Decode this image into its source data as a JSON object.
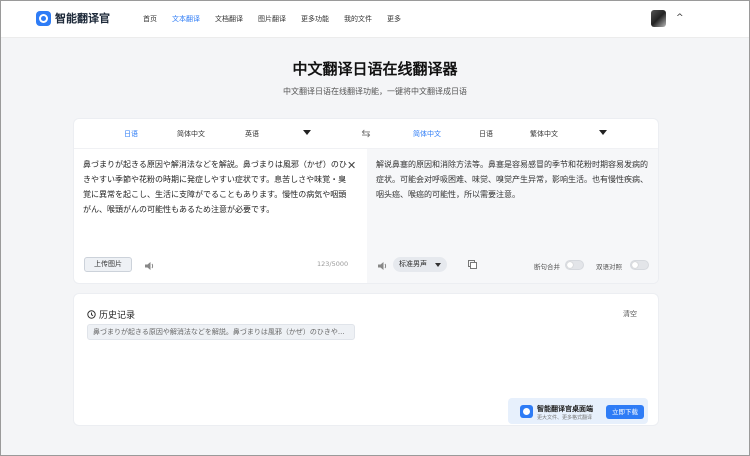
{
  "brand": {
    "name": "智能翻译官",
    "accent": "#2e7cf6"
  },
  "nav": {
    "items": [
      {
        "label": "首页",
        "active": false
      },
      {
        "label": "文本翻译",
        "active": true
      },
      {
        "label": "文档翻译",
        "active": false
      },
      {
        "label": "图片翻译",
        "active": false
      },
      {
        "label": "更多功能",
        "active": false
      },
      {
        "label": "我的文件",
        "active": false
      },
      {
        "label": "更多",
        "active": false
      }
    ],
    "user_caret": "^"
  },
  "heading": {
    "title": "中文翻译日语在线翻译器",
    "subtitle": "中文翻译日语在线翻译功能，一键将中文翻译成日语"
  },
  "translator": {
    "source_langs": [
      "日语",
      "简体中文",
      "英语"
    ],
    "target_langs": [
      "简体中文",
      "日语",
      "繁体中文"
    ],
    "swap_icon": "swap-arrows-icon",
    "source_text": "鼻づまりが起きる原因や解消法などを解説。鼻づまりは風邪（かぜ）のひきやすい季節や花粉の時期に発症しやすい症状です。息苦しさや味覚・臭覚に異常を起こし、生活に支障がでることもあります。慢性の病気や咽頭がん、喉頭がんの可能性もあるため注意が必要です。",
    "target_text": "解说鼻塞的原因和消除方法等。鼻塞是容易感冒的季节和花粉时期容易发病的症状。可能会对呼吸困难、味觉、嗅觉产生异常，影响生活。也有慢性疾病、咽头癌、喉癌的可能性，所以需要注意。",
    "upload_label": "上传图片",
    "char_count": "123/5000",
    "voice_label": "标准男声",
    "toggle_newline_label": "断句合并",
    "toggle_bilingual_label": "双语对照"
  },
  "history": {
    "title": "历史记录",
    "clear_label": "清空",
    "items": [
      "鼻づまりが起きる原因や解消法などを解説。鼻づまりは風邪（かぜ）のひきや..."
    ]
  },
  "promo": {
    "title": "智能翻译官桌面端",
    "subtitle": "更大文件、更多格式翻译",
    "button_label": "立即下载"
  }
}
